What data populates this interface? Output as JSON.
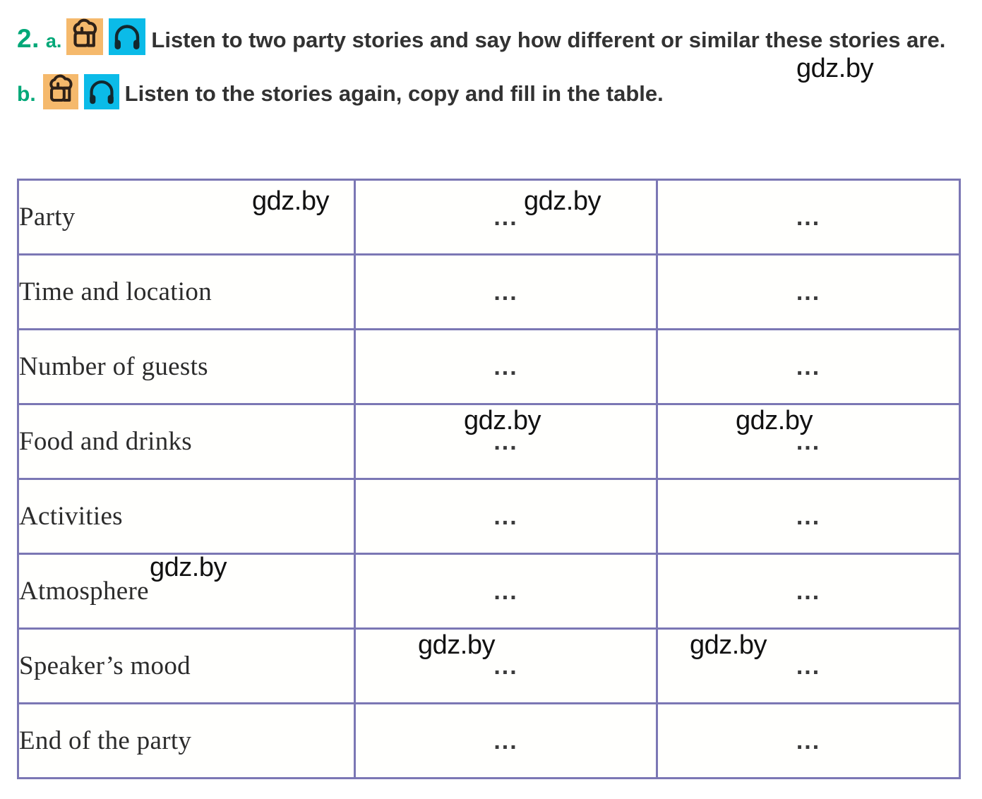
{
  "exercise": {
    "number": "2.",
    "part_a": {
      "letter": "a.",
      "text": "Listen to two party stories and say how different or similar these stories are.",
      "icons": [
        "cupcake-icon",
        "headphones-icon"
      ]
    },
    "part_b": {
      "letter": "b.",
      "text": "Listen to the stories again, copy and fill in the table.",
      "icons": [
        "cupcake-icon",
        "headphones-icon"
      ]
    }
  },
  "colors": {
    "accent_green": "#00a878",
    "text_dark": "#323232",
    "table_border": "#7b77b4",
    "cupcake_badge_bg": "#f5b96c",
    "headphones_badge_bg": "#0bbbe8",
    "icon_stroke": "#2e2118"
  },
  "table": {
    "columns": [
      "",
      "",
      ""
    ],
    "placeholder": "...",
    "rows": [
      {
        "label": "Party",
        "story_a": "...",
        "story_b": "..."
      },
      {
        "label": "Time and location",
        "story_a": "...",
        "story_b": "..."
      },
      {
        "label": "Number of guests",
        "story_a": "...",
        "story_b": "..."
      },
      {
        "label": "Food and drinks",
        "story_a": "...",
        "story_b": "..."
      },
      {
        "label": "Activities",
        "story_a": "...",
        "story_b": "..."
      },
      {
        "label": "Atmosphere",
        "story_a": "...",
        "story_b": "..."
      },
      {
        "label": "Speaker’s mood",
        "story_a": "...",
        "story_b": "..."
      },
      {
        "label": "End of the party",
        "story_a": "...",
        "story_b": "..."
      }
    ]
  },
  "watermarks": {
    "text": "gdz.by",
    "count": 8
  }
}
